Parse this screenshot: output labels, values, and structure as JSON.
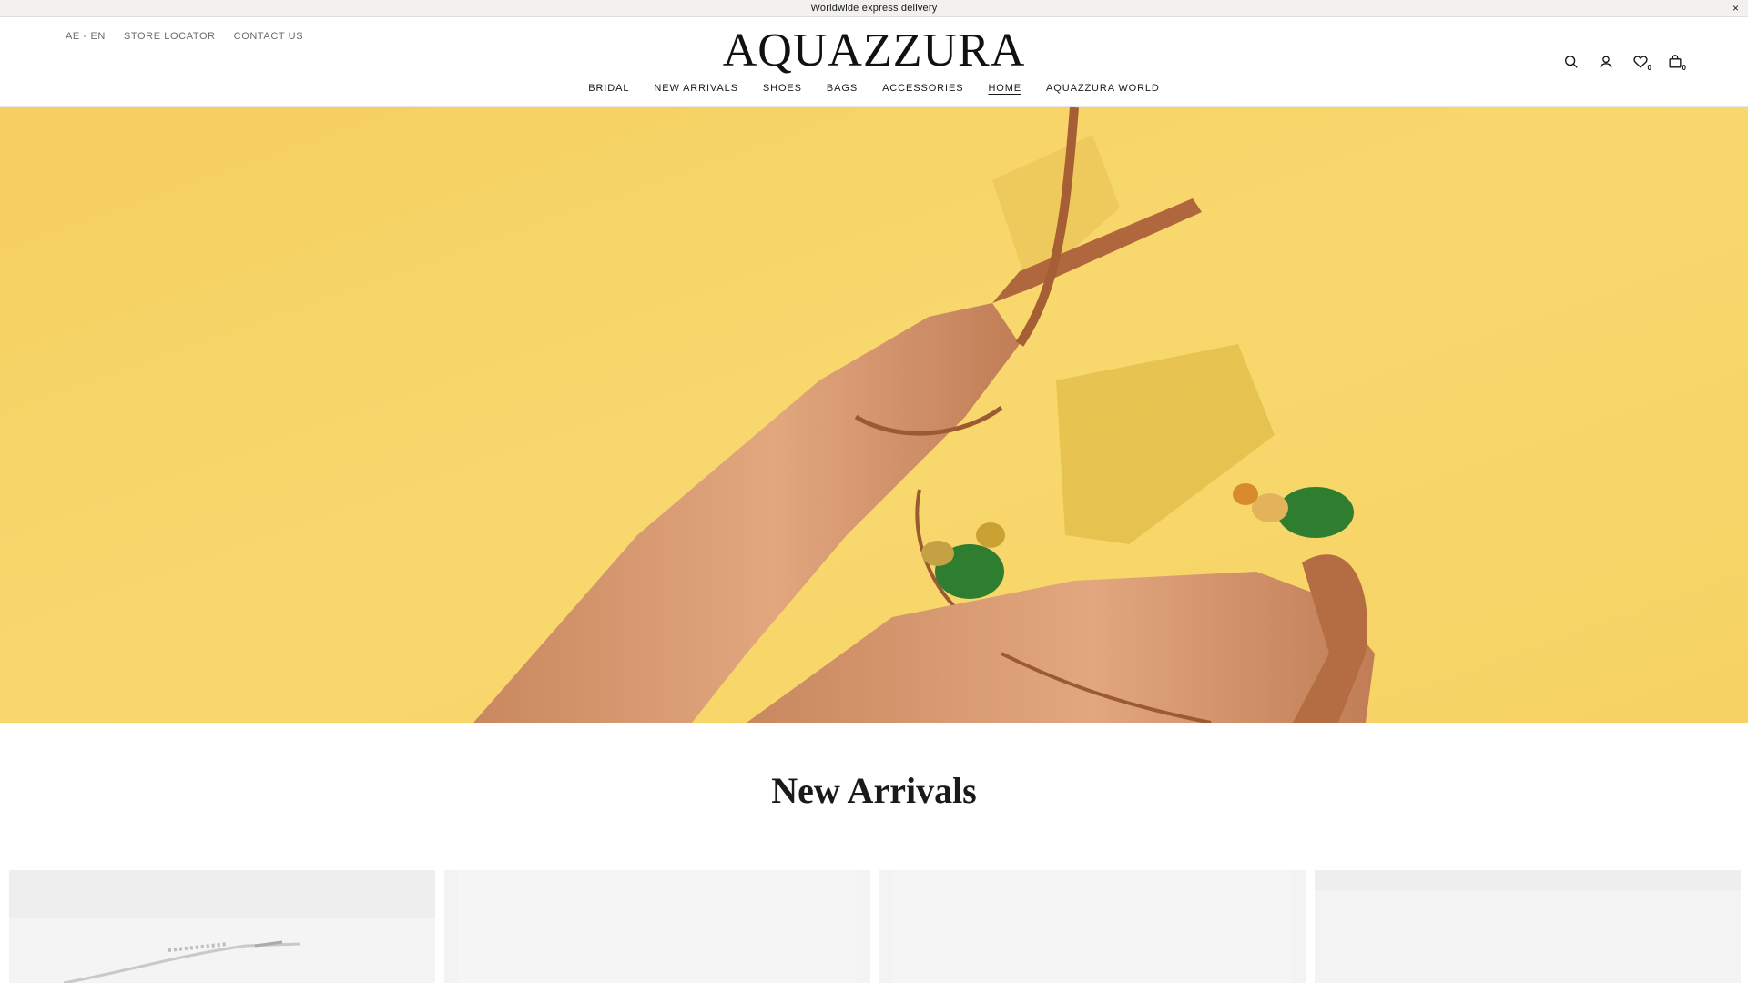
{
  "announcement": {
    "text": "Worldwide express delivery",
    "close": "×"
  },
  "header": {
    "util_links": [
      "AE - EN",
      "STORE LOCATOR",
      "CONTACT US"
    ],
    "logo": "AQUAZZURA",
    "icons": [
      "search-icon",
      "account-icon",
      "wishlist-icon",
      "bag-icon"
    ],
    "wishlist_count": "0",
    "bag_count": "0",
    "nav": [
      "BRIDAL",
      "NEW ARRIVALS",
      "SHOES",
      "BAGS",
      "ACCESSORIES",
      "HOME",
      "AQUAZZURA WORLD"
    ],
    "active_nav": "HOME"
  },
  "hero": {
    "background": "#f7d56a"
  },
  "section": {
    "title": "New Arrivals"
  },
  "products": [
    {
      "icon": "product-image"
    },
    {
      "icon": "product-image"
    },
    {
      "icon": "product-image"
    },
    {
      "icon": "product-image"
    }
  ]
}
